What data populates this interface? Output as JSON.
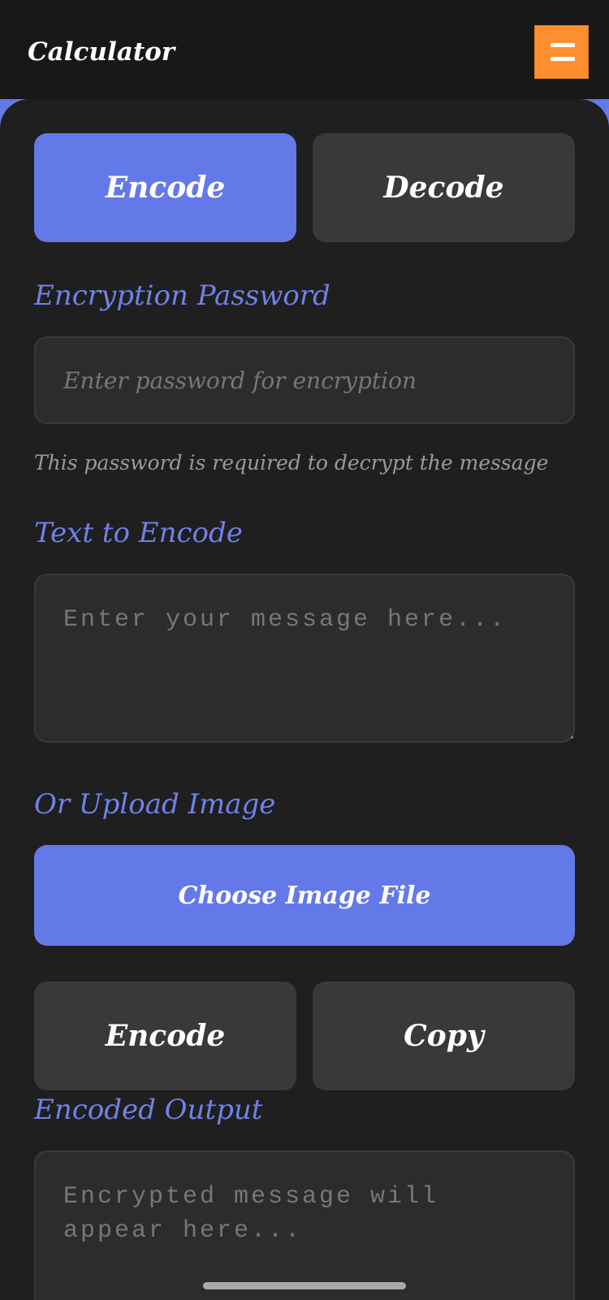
{
  "header": {
    "title": "Calculator",
    "menu_icon": "hamburger-menu-icon",
    "menu_color": "#ff8f2e"
  },
  "tabs": {
    "encode_label": "Encode",
    "decode_label": "Decode",
    "active": "Encode"
  },
  "password": {
    "label": "Encryption Password",
    "placeholder": "Enter password for encryption",
    "value": "",
    "hint": "This password is required to decrypt the message"
  },
  "text_input": {
    "label": "Text to Encode",
    "placeholder": "Enter your message here...",
    "value": ""
  },
  "upload": {
    "label": "Or Upload Image",
    "button_label": "Choose Image File"
  },
  "actions": {
    "encode_label": "Encode",
    "copy_label": "Copy"
  },
  "output": {
    "label": "Encoded Output",
    "placeholder": "Encrypted message will appear here...",
    "value": ""
  },
  "colors": {
    "accent": "#6479e8",
    "label_text": "#6f82e8",
    "background": "#1f1f1f",
    "secondary_button": "#393939"
  }
}
